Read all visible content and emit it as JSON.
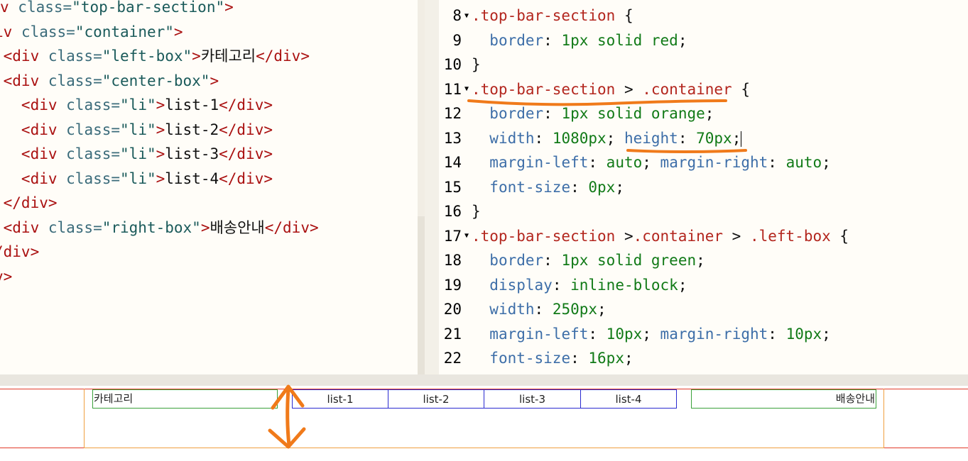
{
  "html_editor": {
    "lines": [
      {
        "tag_open": "v",
        "attr": " class=",
        "str": "\"top-bar-section\"",
        "tag_close": ">",
        "text": ""
      },
      {
        "tag_open": "iv",
        "attr": " class=",
        "str": "\"container\"",
        "tag_close": ">",
        "text": ""
      },
      {
        "tag_open": " <div",
        "attr": " class=",
        "str": "\"left-box\"",
        "tag_close": ">",
        "text": "카테고리",
        "end_tag": "</div>"
      },
      {
        "tag_open": " <div",
        "attr": " class=",
        "str": "\"center-box\"",
        "tag_close": ">",
        "text": ""
      },
      {
        "tag_open": "   <div",
        "attr": " class=",
        "str": "\"li\"",
        "tag_close": ">",
        "text": "list-1",
        "end_tag": "</div>"
      },
      {
        "tag_open": "   <div",
        "attr": " class=",
        "str": "\"li\"",
        "tag_close": ">",
        "text": "list-2",
        "end_tag": "</div>"
      },
      {
        "tag_open": "   <div",
        "attr": " class=",
        "str": "\"li\"",
        "tag_close": ">",
        "text": "list-3",
        "end_tag": "</div>"
      },
      {
        "tag_open": "   <div",
        "attr": " class=",
        "str": "\"li\"",
        "tag_close": ">",
        "text": "list-4",
        "end_tag": "</div>"
      },
      {
        "tag_open": " </div>",
        "attr": "",
        "str": "",
        "tag_close": "",
        "text": ""
      },
      {
        "tag_open": " <div",
        "attr": " class=",
        "str": "\"right-box\"",
        "tag_close": ">",
        "text": "배송안내",
        "end_tag": "</div>"
      },
      {
        "tag_open": "/div>",
        "attr": "",
        "str": "",
        "tag_close": "",
        "text": ""
      },
      {
        "tag_open": "v>",
        "attr": "",
        "str": "",
        "tag_close": "",
        "text": ""
      }
    ]
  },
  "css_editor": {
    "lines": [
      {
        "num": "8",
        "fold": true,
        "sel": ".top-bar-section",
        "rest": " {"
      },
      {
        "num": "9",
        "prop": "border",
        "val": "1px solid red"
      },
      {
        "num": "10",
        "close": "}"
      },
      {
        "num": "11",
        "fold": true,
        "sel": ".top-bar-section",
        "mid": " > ",
        "sel2": ".container",
        "rest": " {"
      },
      {
        "num": "12",
        "prop": "border",
        "val": "1px solid orange"
      },
      {
        "num": "13",
        "prop": "width",
        "val": "1080px",
        "prop2": "height",
        "val2": "70px"
      },
      {
        "num": "14",
        "prop": "margin-left",
        "val": "auto",
        "prop2": "margin-right",
        "val2": "auto"
      },
      {
        "num": "15",
        "prop": "font-size",
        "val": "0px"
      },
      {
        "num": "16",
        "close": "}"
      },
      {
        "num": "17",
        "fold": true,
        "sel": ".top-bar-section",
        "mid": " >",
        "sel2": ".container",
        "mid2": " > ",
        "sel3": ".left-box",
        "rest": " {"
      },
      {
        "num": "18",
        "prop": "border",
        "val": "1px solid green"
      },
      {
        "num": "19",
        "prop": "display",
        "val": "inline-block"
      },
      {
        "num": "20",
        "prop": "width",
        "val": "250px"
      },
      {
        "num": "21",
        "prop": "margin-left",
        "val": "10px",
        "prop2": "margin-right",
        "val2": "10px"
      },
      {
        "num": "22",
        "prop": "font-size",
        "val": "16px"
      }
    ]
  },
  "preview": {
    "left_box": "카테고리",
    "list_items": [
      "list-1",
      "list-2",
      "list-3",
      "list-4"
    ],
    "right_box": "배송안내"
  },
  "colors": {
    "annotation": "#f07a1a",
    "red_border": "#e23b2a",
    "orange_border": "#f0a040",
    "green_border": "#3aa13a",
    "blue_border": "#2a2ad0"
  }
}
